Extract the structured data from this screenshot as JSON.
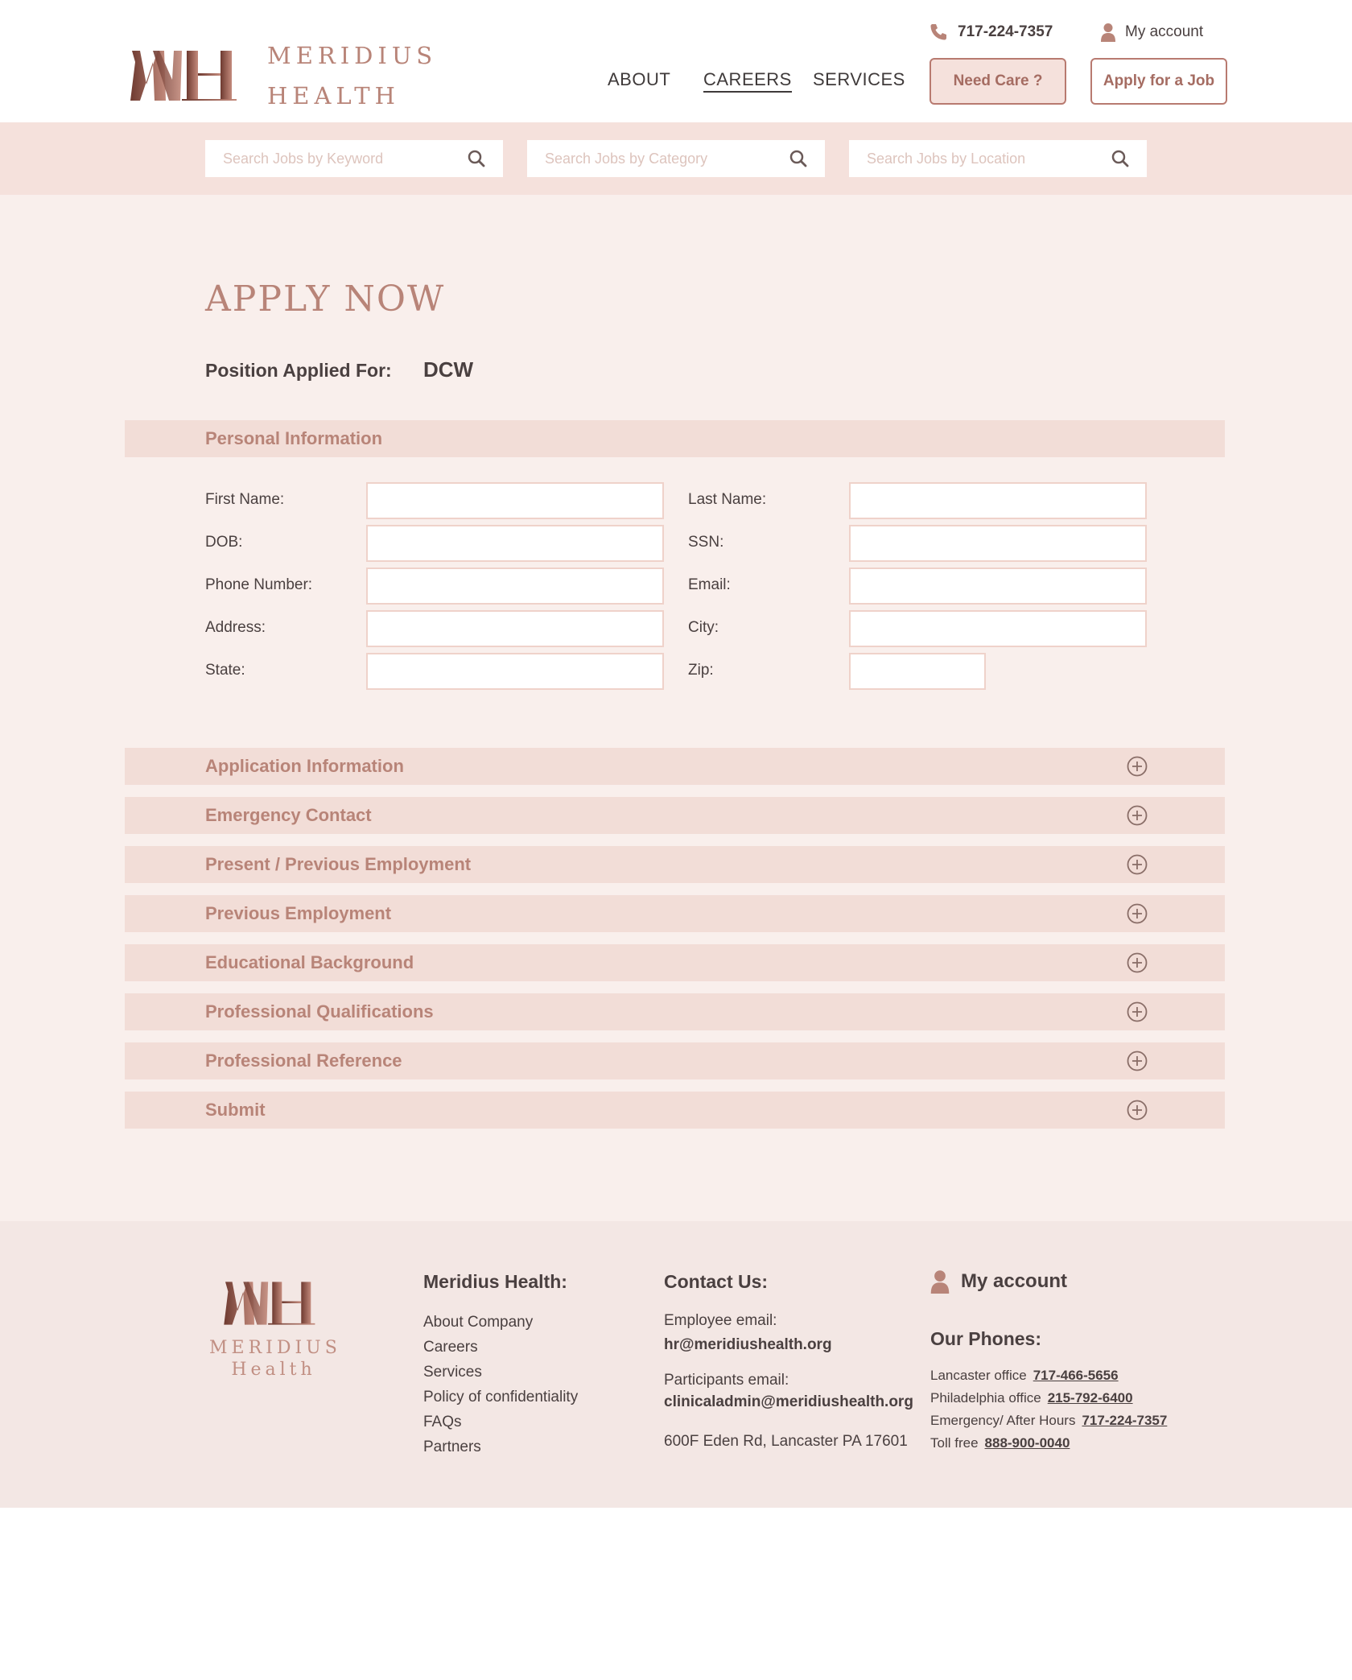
{
  "brand": {
    "logo_line1": "MERIDIUS",
    "logo_line2": "HEALTH",
    "footer_line1": "MERIDIUS",
    "footer_line2": "Health",
    "accent_color": "#b88478"
  },
  "header": {
    "phone": "717-224-7357",
    "account": "My account",
    "nav": [
      "ABOUT",
      "CAREERS",
      "SERVICES"
    ],
    "need_care": "Need Care ?",
    "apply_job": "Apply for a Job"
  },
  "search": {
    "keyword_placeholder": "Search Jobs by Keyword",
    "category_placeholder": "Search Jobs by Category",
    "location_placeholder": "Search Jobs by Location"
  },
  "form": {
    "title": "APPLY NOW",
    "position_label": "Position Applied For:",
    "position_value": "DCW",
    "personal_section": "Personal Information",
    "fields": {
      "first_name": "First Name:",
      "last_name": "Last Name:",
      "dob": "DOB:",
      "ssn": "SSN:",
      "phone": "Phone Number:",
      "email": "Email:",
      "address": "Address:",
      "city": "City:",
      "state": "State:",
      "zip": "Zip:"
    },
    "sections": [
      "Application Information",
      "Emergency Contact",
      "Present / Previous Employment",
      "Previous Employment",
      "Educational Background",
      "Professional Qualifications",
      "Professional Reference",
      "Submit"
    ]
  },
  "footer": {
    "company_heading": "Meridius Health:",
    "links": [
      "About Company",
      "Careers",
      "Services",
      "Policy of confidentiality",
      "FAQs",
      "Partners"
    ],
    "contact_heading": "Contact Us:",
    "employee_label": "Employee email:",
    "employee_email": "hr@meridiushealth.org",
    "participants_label": "Participants email:",
    "participants_email": "clinicaladmin@meridiushealth.org",
    "address": "600F Eden Rd, Lancaster PA 17601",
    "account": "My account",
    "phones_heading": "Our Phones:",
    "phones": [
      {
        "label": "Lancaster office",
        "number": "717-466-5656"
      },
      {
        "label": "Philadelphia office",
        "number": "215-792-6400"
      },
      {
        "label": "Emergency/ After Hours",
        "number": "717-224-7357"
      },
      {
        "label": "Toll free",
        "number": "888-900-0040"
      }
    ]
  }
}
